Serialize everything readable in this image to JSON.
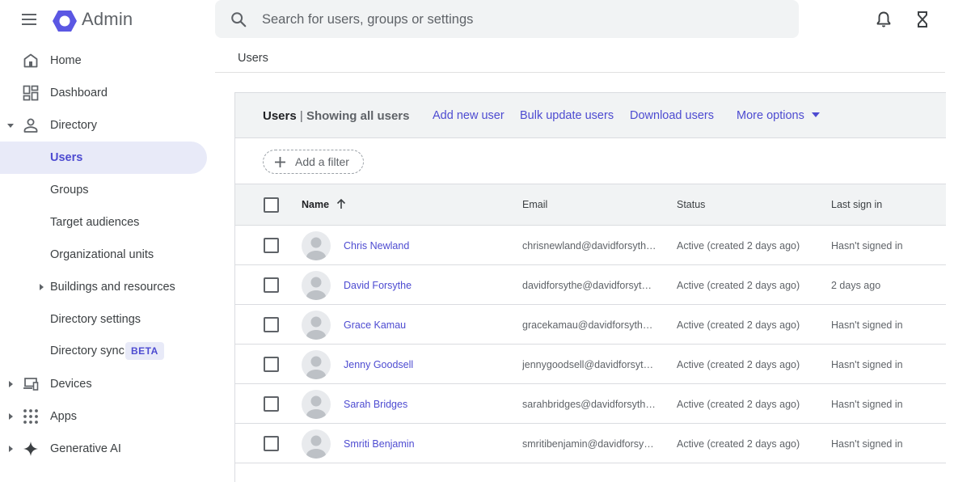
{
  "app": {
    "name": "Admin"
  },
  "search": {
    "placeholder": "Search for users, groups or settings"
  },
  "top_icons": [
    "bell-icon",
    "hourglass-icon"
  ],
  "sidebar": {
    "items": [
      {
        "label": "Home",
        "icon": "home-icon"
      },
      {
        "label": "Dashboard",
        "icon": "dashboard-icon"
      },
      {
        "label": "Directory",
        "icon": "person-icon",
        "expanded": true
      },
      {
        "label": "Users",
        "active": true
      },
      {
        "label": "Groups"
      },
      {
        "label": "Target audiences"
      },
      {
        "label": "Organizational units"
      },
      {
        "label": "Buildings and resources",
        "collapsed": true
      },
      {
        "label": "Directory settings"
      },
      {
        "label": "Directory sync",
        "badge": "BETA"
      },
      {
        "label": "Devices",
        "icon": "devices-icon"
      },
      {
        "label": "Apps",
        "icon": "apps-grid-icon"
      },
      {
        "label": "Generative AI",
        "icon": "sparkle-icon"
      }
    ]
  },
  "breadcrumb": "Users",
  "users_card": {
    "title": "Users",
    "separator": "|",
    "subtitle": "Showing all users",
    "actions": {
      "add": "Add new user",
      "bulk": "Bulk update users",
      "download": "Download users",
      "more": "More options"
    },
    "filter_label": "Add a filter",
    "columns": {
      "name": "Name",
      "email": "Email",
      "status": "Status",
      "last_sign_in": "Last sign in"
    },
    "rows": [
      {
        "name": "Chris Newland",
        "email": "chrisnewland@davidforsyth…",
        "status": "Active (created 2 days ago)",
        "last_sign_in": "Hasn't signed in"
      },
      {
        "name": "David Forsythe",
        "email": "davidforsythe@davidforsyt…",
        "status": "Active (created 2 days ago)",
        "last_sign_in": "2 days ago"
      },
      {
        "name": "Grace Kamau",
        "email": "gracekamau@davidforsyth…",
        "status": "Active (created 2 days ago)",
        "last_sign_in": "Hasn't signed in"
      },
      {
        "name": "Jenny Goodsell",
        "email": "jennygoodsell@davidforsyt…",
        "status": "Active (created 2 days ago)",
        "last_sign_in": "Hasn't signed in"
      },
      {
        "name": "Sarah Bridges",
        "email": "sarahbridges@davidforsyth…",
        "status": "Active (created 2 days ago)",
        "last_sign_in": "Hasn't signed in"
      },
      {
        "name": "Smriti Benjamin",
        "email": "smritibenjamin@davidforsy…",
        "status": "Active (created 2 days ago)",
        "last_sign_in": "Hasn't signed in"
      }
    ]
  },
  "colors": {
    "accent": "#4d4bd1",
    "active_nav_bg": "#e8eaf8",
    "header_bg": "#f1f3f4",
    "divider": "#dadce0"
  }
}
